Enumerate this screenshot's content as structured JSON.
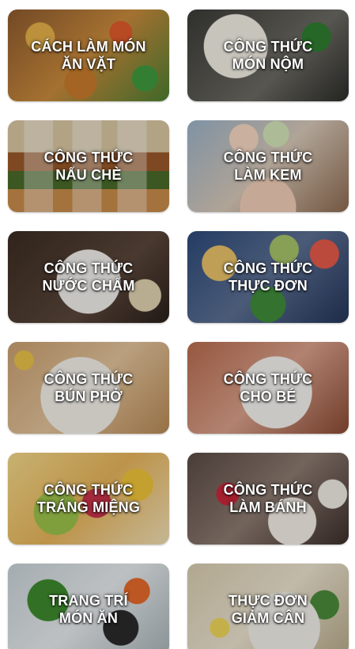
{
  "categories": [
    {
      "line1": "CÁCH LÀM MÓN",
      "line2": "ĂN VẶT",
      "image": "snack-food-photo"
    },
    {
      "line1": "CÔNG THỨC",
      "line2": "MÓN NỘM",
      "image": "salad-photo"
    },
    {
      "line1": "CÔNG THỨC",
      "line2": "NẤU CHÈ",
      "image": "sweet-soup-photo"
    },
    {
      "line1": "CÔNG THỨC",
      "line2": "LÀM KEM",
      "image": "ice-cream-photo"
    },
    {
      "line1": "CÔNG THỨC",
      "line2": "NƯỚC CHẤM",
      "image": "dipping-sauce-photo"
    },
    {
      "line1": "CÔNG THỨC",
      "line2": "THỰC ĐƠN",
      "image": "menu-dishes-photo"
    },
    {
      "line1": "CÔNG THỨC",
      "line2": "BÚN PHỞ",
      "image": "pho-noodle-photo"
    },
    {
      "line1": "CÔNG THỨC",
      "line2": "CHO BÉ",
      "image": "baby-food-photo"
    },
    {
      "line1": "CÔNG THỨC",
      "line2": "TRÁNG MIỆNG",
      "image": "dessert-photo"
    },
    {
      "line1": "CÔNG THỨC",
      "line2": "LÀM BÁNH",
      "image": "cake-photo"
    },
    {
      "line1": "TRANG TRÍ",
      "line2": "MÓN ĂN",
      "image": "food-decoration-photo"
    },
    {
      "line1": "THỰC ĐƠN",
      "line2": "GIẢM CÂN",
      "image": "diet-meal-photo"
    }
  ]
}
